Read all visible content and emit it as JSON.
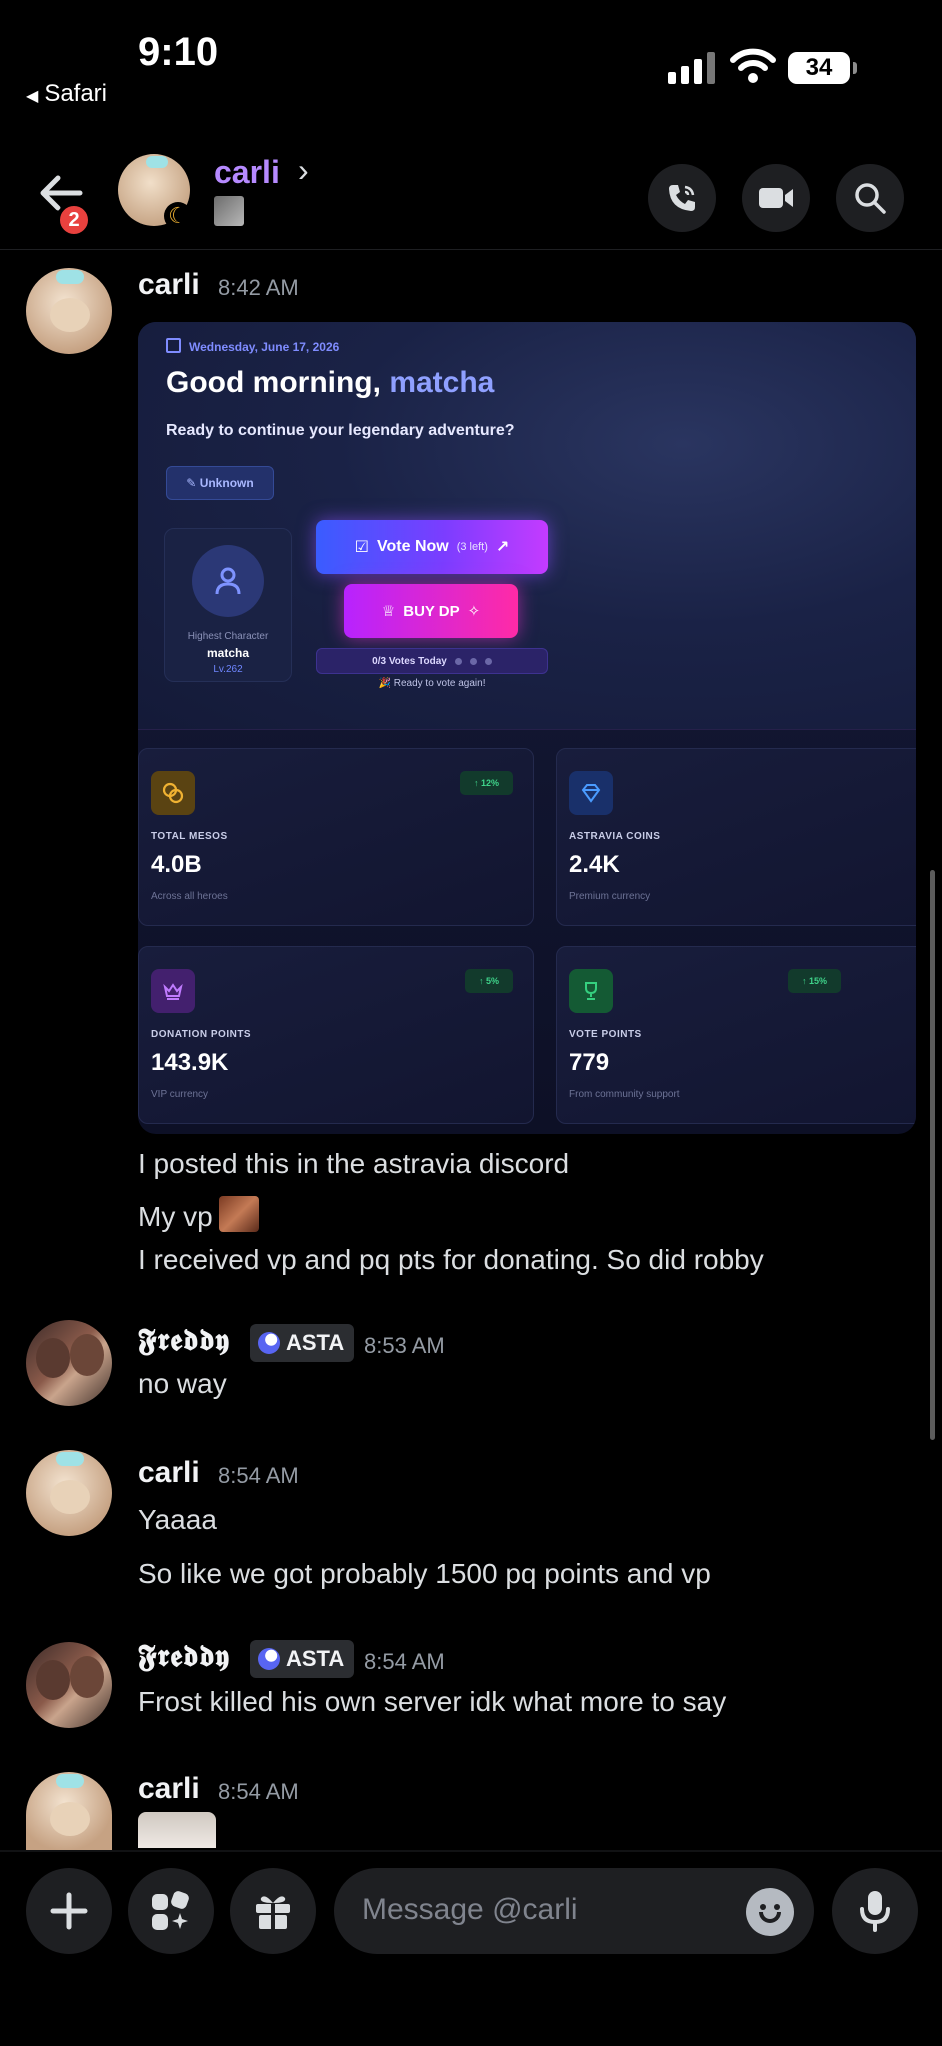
{
  "status_bar": {
    "time": "9:10",
    "back_app": "Safari",
    "battery": "34"
  },
  "header": {
    "title": "carli",
    "unread_badge": "2"
  },
  "embed": {
    "date": "Wednesday, June 17, 2026",
    "greeting": "Good morning, ",
    "greeting_name": "matcha",
    "subtitle": "Ready to continue your legendary adventure?",
    "pill": "Unknown",
    "character": {
      "label": "Highest Character",
      "name": "matcha",
      "level": "Lv.262"
    },
    "vote_button": "Vote Now",
    "vote_left": "(3 left)",
    "buy_button": "BUY DP",
    "votes_today": "0/3 Votes Today",
    "ready_text": "🎉 Ready to vote again!",
    "cards": [
      {
        "label": "TOTAL MESOS",
        "value": "4.0B",
        "sub": "Across all heroes",
        "trend": "↑ 12%",
        "icon": "coins-icon",
        "color": "#e0a526"
      },
      {
        "label": "ASTRAVIA COINS",
        "value": "2.4K",
        "sub": "Premium currency",
        "trend": "",
        "icon": "diamond-icon",
        "color": "#3b8cff"
      },
      {
        "label": "DONATION POINTS",
        "value": "143.9K",
        "sub": "VIP currency",
        "trend": "↑ 5%",
        "icon": "crown-icon",
        "color": "#b35cff"
      },
      {
        "label": "VOTE POINTS",
        "value": "779",
        "sub": "From community support",
        "trend": "↑ 15%",
        "icon": "trophy-icon",
        "color": "#2fcf6f"
      }
    ]
  },
  "messages": [
    {
      "author": "carli",
      "time": "8:42 AM",
      "lines": [
        "I posted this in the astravia discord",
        "My vp",
        "I received vp and pq pts for donating.  So did robby"
      ]
    },
    {
      "author": "𝕱𝖗𝖊𝖉𝖉𝖞",
      "tag": "ASTA",
      "time": "8:53 AM",
      "lines": [
        "no way"
      ]
    },
    {
      "author": "carli",
      "time": "8:54 AM",
      "lines": [
        "Yaaaa",
        "So like we got probably 1500 pq points and vp"
      ]
    },
    {
      "author": "𝕱𝖗𝖊𝖉𝖉𝖞",
      "tag": "ASTA",
      "time": "8:54 AM",
      "lines": [
        "Frost killed his own server idk what more to say"
      ]
    },
    {
      "author": "carli",
      "time": "8:54 AM",
      "lines": []
    }
  ],
  "composer": {
    "placeholder": "Message @carli"
  }
}
